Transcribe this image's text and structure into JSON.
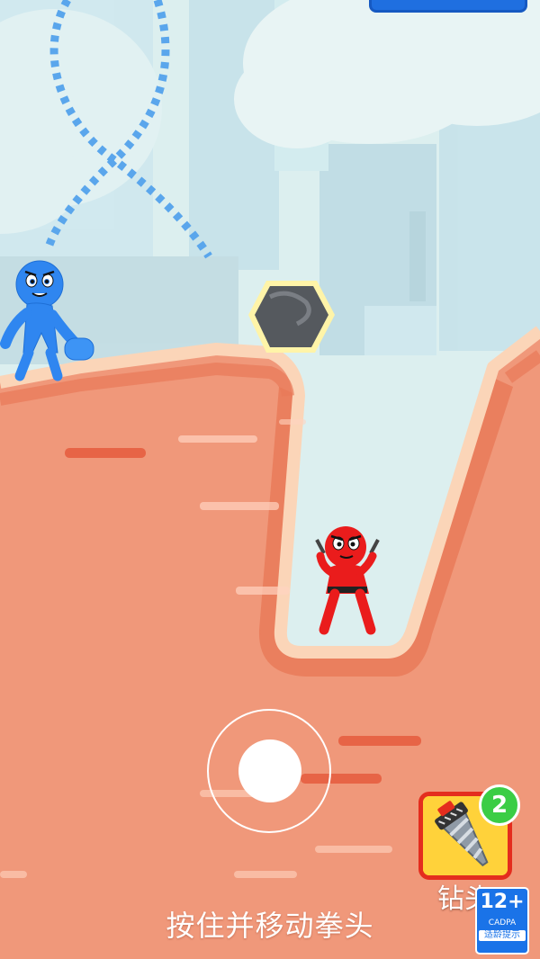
{
  "game": {
    "hint_text": "按住并移动拳头",
    "powerup": {
      "label": "钻头",
      "count": "2",
      "icon": "drill-icon"
    },
    "age_rating": {
      "rating": "12+",
      "organization": "CADPA",
      "label": "适龄提示"
    },
    "characters": [
      {
        "name": "blue-stickman",
        "color": "#2f86f0"
      },
      {
        "name": "red-ninja",
        "color": "#ea1c1c"
      }
    ],
    "colors": {
      "sky": "#dcefef",
      "ground": "#f0987a",
      "ground_edge": "#fbd5b8",
      "rope": "#5aa6ec",
      "boulder": "#55595e",
      "boulder_outline": "#fff4a8"
    }
  }
}
